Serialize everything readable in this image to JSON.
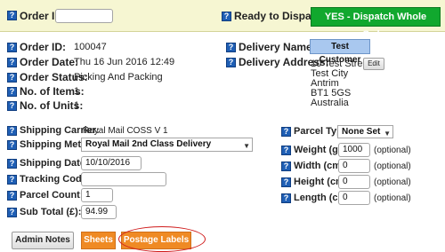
{
  "topbar": {
    "order_id_label": "Order ID:",
    "order_id_value": "",
    "ready_label": "Ready to Dispatch?",
    "dispatch_button": "YES - Dispatch Whole Order"
  },
  "order": {
    "order_id_label": "Order ID:",
    "order_id": "100047",
    "order_date_label": "Order Date:",
    "order_date": "Thu 16 Jun 2016 12:49",
    "order_status_label": "Order Status:",
    "order_status": "Picking And Packing",
    "items_label": "No. of Items:",
    "items": "1",
    "units_label": "No. of Units:",
    "units": "1"
  },
  "delivery": {
    "name_label": "Delivery Name:",
    "name": "Test Customer",
    "address_label": "Delivery Address:",
    "address_lines": [
      "10 Test Street",
      "Test City",
      "Antrim",
      "BT1 5GS",
      "Australia"
    ],
    "edit_button": "Edit"
  },
  "shipping": {
    "carrier_label": "Shipping Carrier:",
    "carrier": "Royal Mail COSS V 1",
    "method_label": "Shipping Method:",
    "method": "Royal Mail 2nd Class Delivery",
    "date_label": "Shipping Date:",
    "date": "10/10/2016",
    "tracking_label": "Tracking Code:",
    "tracking": "",
    "parcel_count_label": "Parcel Count:",
    "parcel_count": "1",
    "subtotal_label": "Sub Total (£):",
    "subtotal": "94.99"
  },
  "parcel": {
    "type_label": "Parcel Type:",
    "type": "None Set",
    "weight_label": "Weight (g):",
    "weight": "1000",
    "width_label": "Width (cm):",
    "width": "0",
    "height_label": "Height (cm):",
    "height": "0",
    "length_label": "Length (cm):",
    "length": "0",
    "optional": "(optional)"
  },
  "buttons": {
    "admin_notes": "Admin Notes",
    "sheets": "Sheets",
    "postage_labels": "Postage Labels"
  },
  "icons": {
    "help": "help-icon"
  },
  "colors": {
    "topbar_bg": "#f6f6d2",
    "dispatch_green": "#11a82e",
    "help_blue": "#1f5fb5",
    "customer_box": "#a9c8ef",
    "orange_button": "#ef8a24",
    "highlight_oval": "#d01c1c"
  }
}
